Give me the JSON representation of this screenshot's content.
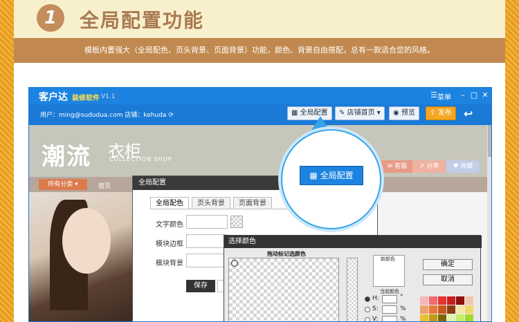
{
  "header": {
    "step": "1",
    "title": "全局配置功能",
    "subtitle": "模板内置强大（全局配色、页头背景、页面背景）功能，颜色、背景自由搭配，总有一款适合您的风格。"
  },
  "app": {
    "brand": "客户达",
    "brand_sub": "装修软件",
    "version": "V1.1",
    "menu_label": "菜单",
    "user_info": "用户：ming@sududua.com   店铺：kehuda",
    "toolbar": {
      "global_config": "全局配置",
      "shop_home": "店铺首页",
      "preview": "预览",
      "publish": "发布"
    },
    "shop": {
      "logo_cn": "潮流",
      "logo_word": "衣柜",
      "logo_en": "COLLECTION SHOP",
      "nav_category": "所有分类",
      "nav_home": "首页",
      "service": "客服",
      "share": "分享",
      "favorite": "收藏"
    },
    "dialog": {
      "title": "全局配置",
      "tabs": [
        "全局配色",
        "页头背景",
        "页面背景"
      ],
      "fields": [
        "文字颜色",
        "模块边框",
        "模块背景"
      ],
      "save": "保存"
    },
    "picker": {
      "title": "选择颜色",
      "drag_tip": "拖动标记选颜色",
      "new_color": "新颜色",
      "current_color": "当前颜色",
      "h_label": "H:",
      "s_label": "S:",
      "v_label": "V:",
      "unit_deg": "°",
      "unit_pct": "%",
      "ok": "确定",
      "cancel": "取消",
      "palette": [
        "#f4b6b6",
        "#f06a6a",
        "#e63232",
        "#c81e1e",
        "#8c1010",
        "#f1c7b0",
        "#f0a070",
        "#e87838",
        "#c8581c",
        "#8a3c10",
        "#f4e6a6",
        "#f0d868",
        "#e8c030",
        "#c09a10",
        "#7e6408",
        "#dff4a6",
        "#c4ec68",
        "#a0d830",
        "#78b010",
        "#4c7808"
      ]
    }
  },
  "callout": {
    "label": "全局配置"
  }
}
